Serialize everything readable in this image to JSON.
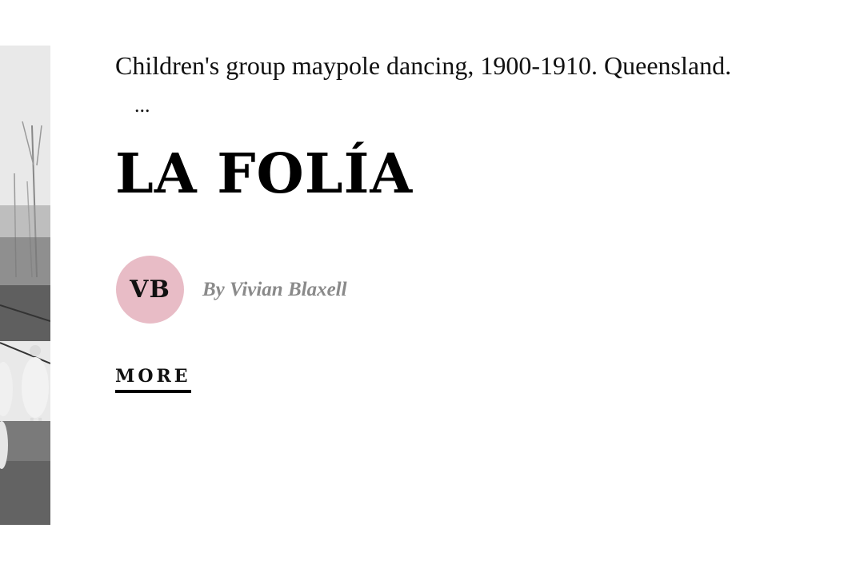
{
  "article": {
    "caption": "Children's group maypole dancing, 1900-1910. Queensland.",
    "ellipsis": "...",
    "title": "LA FOLÍA",
    "author": {
      "initials": "VB",
      "byline": "By Vivian Blaxell",
      "avatar_color": "#e8bcc6"
    },
    "more_label": "MORE"
  },
  "image": {
    "icon": "photo-maypole-dancing"
  }
}
